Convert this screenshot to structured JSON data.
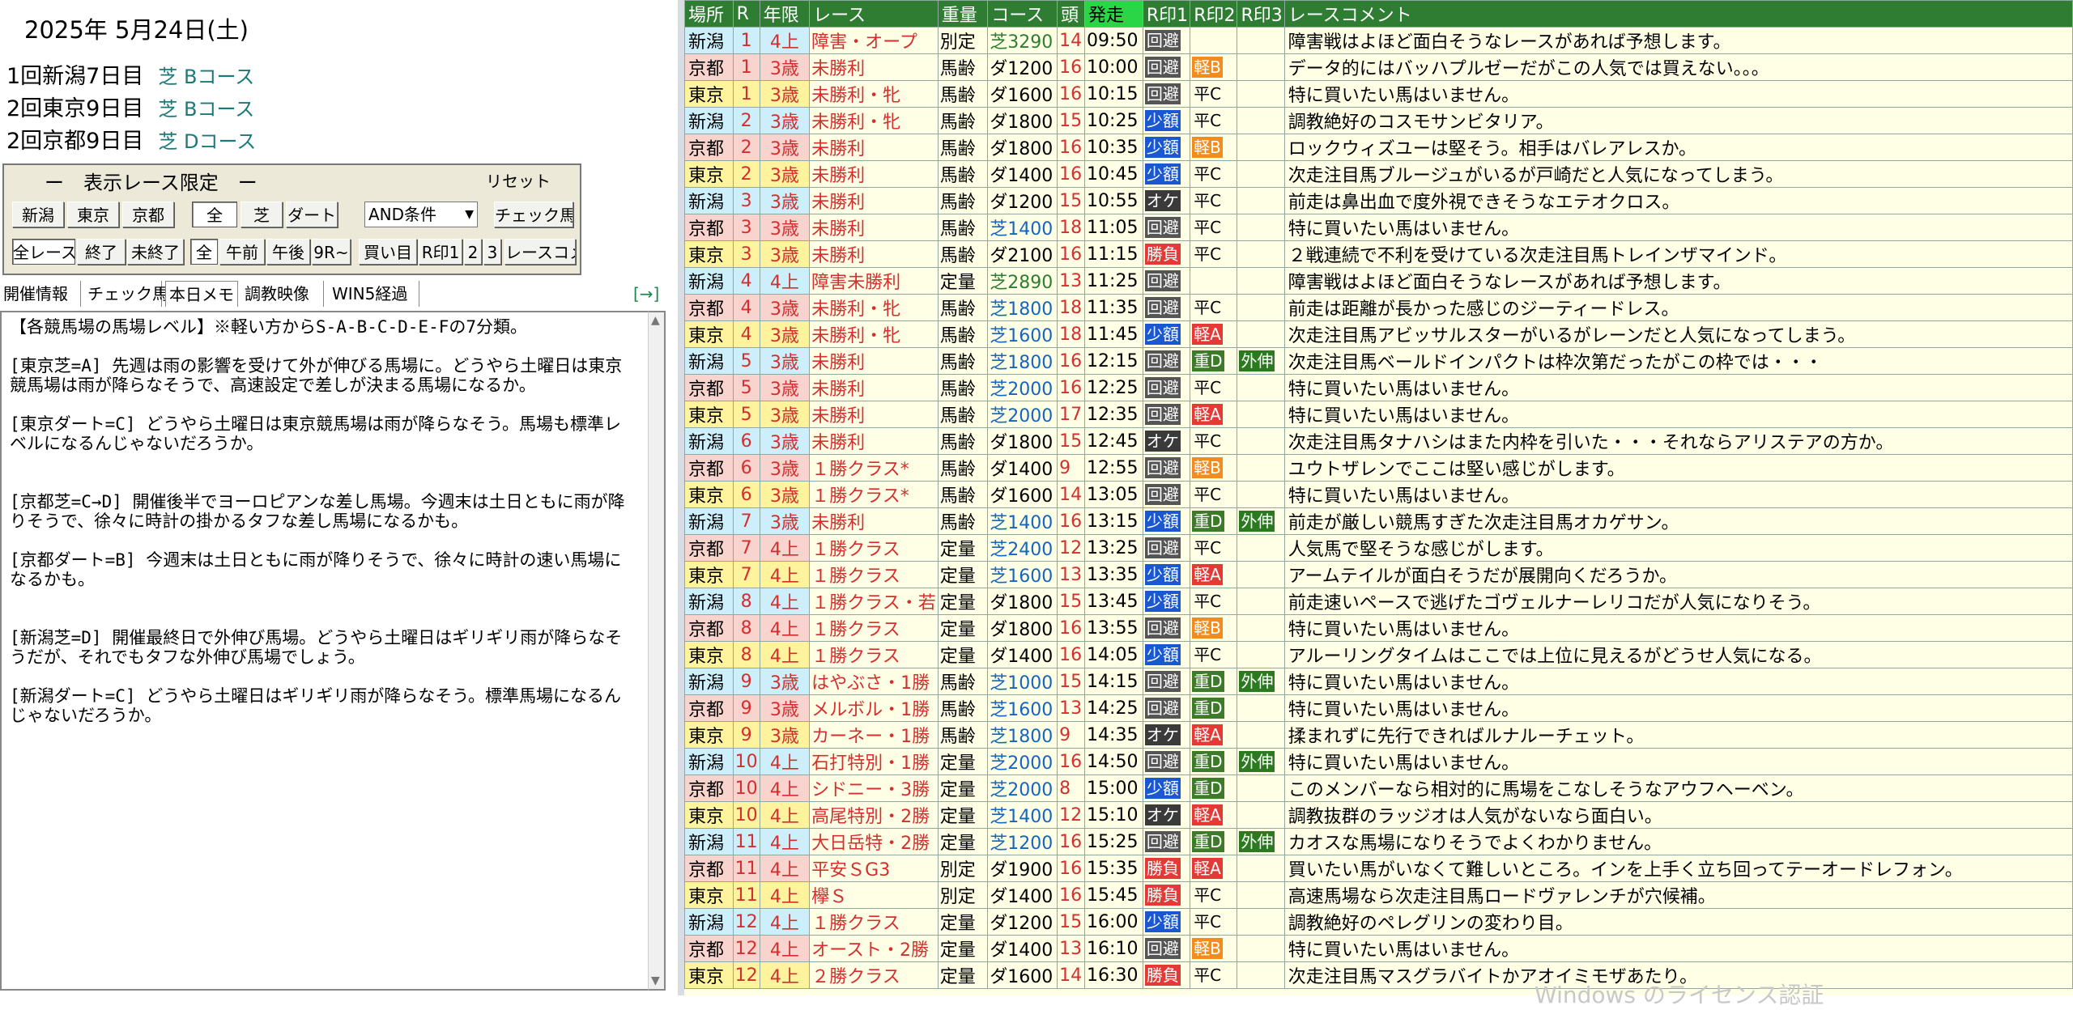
{
  "date": "2025年 5月24日(土)",
  "venues": [
    {
      "meet": "1回新潟7日目",
      "course": "芝 Bコース"
    },
    {
      "meet": "2回東京9日目",
      "course": "芝 Bコース"
    },
    {
      "meet": "2回京都9日目",
      "course": "芝 Dコース"
    }
  ],
  "filter_panel": {
    "title": "ー　表示レース限定　ー",
    "reset_label": "リセット",
    "row1": [
      "新潟",
      "東京",
      "京都",
      "全",
      "芝",
      "ダート"
    ],
    "condition_select": "AND条件",
    "check_horse_button": "チェック馬",
    "row2": [
      "全レース",
      "終了",
      "未終了",
      "全",
      "午前",
      "午後",
      "9R~",
      "買い目",
      "R印1",
      "2",
      "3",
      "レースコメ"
    ]
  },
  "tabs": [
    "開催情報",
    "チェック馬",
    "本日メモ",
    "調教映像",
    "WIN5経過"
  ],
  "active_tab": "本日メモ",
  "arrow_link": "[→]",
  "memo": "【各競馬場の馬場レベル】※軽い方からS-A-B-C-D-E-Fの7分類。\n\n[東京芝=A] 先週は雨の影響を受けて外が伸びる馬場に。どうやら土曜日は東京競馬場は雨が降らなそうで、高速設定で差しが決まる馬場になるか。\n\n[東京ダート=C] どうやら土曜日は東京競馬場は雨が降らなそう。馬場も標準レベルになるんじゃないだろうか。\n\n\n[京都芝=C→D] 開催後半でヨーロピアンな差し馬場。今週末は土日ともに雨が降りそうで、徐々に時計の掛かるタフな差し馬場になるかも。\n\n[京都ダート=B] 今週末は土日ともに雨が降りそうで、徐々に時計の速い馬場になるかも。\n\n\n[新潟芝=D] 開催最終日で外伸び馬場。どうやら土曜日はギリギリ雨が降らなそうだが、それでもタフな外伸び馬場でしょう。\n\n[新潟ダート=C] どうやら土曜日はギリギリ雨が降らなそう。標準馬場になるんじゃないだろうか。",
  "table": {
    "headers": [
      "場所",
      "R",
      "年限",
      "レース",
      "重量",
      "コース",
      "頭",
      "発走",
      "R印1",
      "R印2",
      "R印3",
      "レースコメント"
    ],
    "rows": [
      [
        "新潟",
        "1",
        "4上",
        "障害・オープ",
        "別定",
        "芝3290",
        "14",
        "09:50",
        "回避",
        "",
        "",
        "障害戦はよほど面白そうなレースがあれば予想します。"
      ],
      [
        "京都",
        "1",
        "3歳",
        "未勝利",
        "馬齢",
        "ダ1200",
        "16",
        "10:00",
        "回避",
        "軽B",
        "",
        "データ的にはバッハプルゼーだがこの人気では買えない。。。"
      ],
      [
        "東京",
        "1",
        "3歳",
        "未勝利・牝",
        "馬齢",
        "ダ1600",
        "16",
        "10:15",
        "回避",
        "平C",
        "",
        "特に買いたい馬はいません。"
      ],
      [
        "新潟",
        "2",
        "3歳",
        "未勝利・牝",
        "馬齢",
        "ダ1800",
        "15",
        "10:25",
        "少額",
        "平C",
        "",
        "調教絶好のコスモサンビタリア。"
      ],
      [
        "京都",
        "2",
        "3歳",
        "未勝利",
        "馬齢",
        "ダ1800",
        "16",
        "10:35",
        "少額",
        "軽B",
        "",
        "ロックウィズユーは堅そう。相手はバレアレスか。"
      ],
      [
        "東京",
        "2",
        "3歳",
        "未勝利",
        "馬齢",
        "ダ1400",
        "16",
        "10:45",
        "少額",
        "平C",
        "",
        "次走注目馬ブルージュがいるが戸崎だと人気になってしまう。"
      ],
      [
        "新潟",
        "3",
        "3歳",
        "未勝利",
        "馬齢",
        "ダ1200",
        "15",
        "10:55",
        "オケ",
        "平C",
        "",
        "前走は鼻出血で度外視できそうなエテオクロス。"
      ],
      [
        "京都",
        "3",
        "3歳",
        "未勝利",
        "馬齢",
        "芝1400",
        "18",
        "11:05",
        "回避",
        "平C",
        "",
        "特に買いたい馬はいません。"
      ],
      [
        "東京",
        "3",
        "3歳",
        "未勝利",
        "馬齢",
        "ダ2100",
        "16",
        "11:15",
        "勝負",
        "平C",
        "",
        "２戦連続で不利を受けている次走注目馬トレインザマインド。"
      ],
      [
        "新潟",
        "4",
        "4上",
        "障害未勝利",
        "定量",
        "芝2890",
        "13",
        "11:25",
        "回避",
        "",
        "",
        "障害戦はよほど面白そうなレースがあれば予想します。"
      ],
      [
        "京都",
        "4",
        "3歳",
        "未勝利・牝",
        "馬齢",
        "芝1800",
        "18",
        "11:35",
        "回避",
        "平C",
        "",
        "前走は距離が長かった感じのジーティードレス。"
      ],
      [
        "東京",
        "4",
        "3歳",
        "未勝利・牝",
        "馬齢",
        "芝1600",
        "18",
        "11:45",
        "少額",
        "軽A",
        "",
        "次走注目馬アビッサルスターがいるがレーンだと人気になってしまう。"
      ],
      [
        "新潟",
        "5",
        "3歳",
        "未勝利",
        "馬齢",
        "芝1800",
        "16",
        "12:15",
        "回避",
        "重D",
        "外伸",
        "次走注目馬ベールドインパクトは枠次第だったがこの枠では・・・"
      ],
      [
        "京都",
        "5",
        "3歳",
        "未勝利",
        "馬齢",
        "芝2000",
        "16",
        "12:25",
        "回避",
        "平C",
        "",
        "特に買いたい馬はいません。"
      ],
      [
        "東京",
        "5",
        "3歳",
        "未勝利",
        "馬齢",
        "芝2000",
        "17",
        "12:35",
        "回避",
        "軽A",
        "",
        "特に買いたい馬はいません。"
      ],
      [
        "新潟",
        "6",
        "3歳",
        "未勝利",
        "馬齢",
        "ダ1800",
        "15",
        "12:45",
        "オケ",
        "平C",
        "",
        "次走注目馬タナハシはまた内枠を引いた・・・それならアリステアの方か。"
      ],
      [
        "京都",
        "6",
        "3歳",
        "１勝クラス*",
        "馬齢",
        "ダ1400",
        "9",
        "12:55",
        "回避",
        "軽B",
        "",
        "ユウトザレンでここは堅い感じがします。"
      ],
      [
        "東京",
        "6",
        "3歳",
        "１勝クラス*",
        "馬齢",
        "ダ1600",
        "14",
        "13:05",
        "回避",
        "平C",
        "",
        "特に買いたい馬はいません。"
      ],
      [
        "新潟",
        "7",
        "3歳",
        "未勝利",
        "馬齢",
        "芝1400",
        "16",
        "13:15",
        "少額",
        "重D",
        "外伸",
        "前走が厳しい競馬すぎた次走注目馬オカゲサン。"
      ],
      [
        "京都",
        "7",
        "4上",
        "１勝クラス",
        "定量",
        "芝2400",
        "12",
        "13:25",
        "回避",
        "平C",
        "",
        "人気馬で堅そうな感じがします。"
      ],
      [
        "東京",
        "7",
        "4上",
        "１勝クラス",
        "定量",
        "芝1600",
        "13",
        "13:35",
        "少額",
        "軽A",
        "",
        "アームテイルが面白そうだが展開向くだろうか。"
      ],
      [
        "新潟",
        "8",
        "4上",
        "１勝クラス・若",
        "定量",
        "ダ1800",
        "15",
        "13:45",
        "少額",
        "平C",
        "",
        "前走速いペースで逃げたゴヴェルナーレリコだが人気になりそう。"
      ],
      [
        "京都",
        "8",
        "4上",
        "１勝クラス",
        "定量",
        "ダ1800",
        "16",
        "13:55",
        "回避",
        "軽B",
        "",
        "特に買いたい馬はいません。"
      ],
      [
        "東京",
        "8",
        "4上",
        "１勝クラス",
        "定量",
        "ダ1400",
        "16",
        "14:05",
        "少額",
        "平C",
        "",
        "アルーリングタイムはここでは上位に見えるがどうせ人気になる。"
      ],
      [
        "新潟",
        "9",
        "3歳",
        "はやぶさ・1勝",
        "馬齢",
        "芝1000",
        "15",
        "14:15",
        "回避",
        "重D",
        "外伸",
        "特に買いたい馬はいません。"
      ],
      [
        "京都",
        "9",
        "3歳",
        "メルボル・1勝",
        "馬齢",
        "芝1600",
        "13",
        "14:25",
        "回避",
        "重D",
        "",
        "特に買いたい馬はいません。"
      ],
      [
        "東京",
        "9",
        "3歳",
        "カーネー・1勝",
        "馬齢",
        "芝1800",
        "9",
        "14:35",
        "オケ",
        "軽A",
        "",
        "揉まれずに先行できればルナルーチェット。"
      ],
      [
        "新潟",
        "10",
        "4上",
        "石打特別・1勝",
        "定量",
        "芝2000",
        "16",
        "14:50",
        "回避",
        "重D",
        "外伸",
        "特に買いたい馬はいません。"
      ],
      [
        "京都",
        "10",
        "4上",
        "シドニー・3勝",
        "定量",
        "芝2000",
        "8",
        "15:00",
        "少額",
        "重D",
        "",
        "このメンバーなら相対的に馬場をこなしそうなアウフヘーベン。"
      ],
      [
        "東京",
        "10",
        "4上",
        "高尾特別・2勝",
        "定量",
        "芝1400",
        "12",
        "15:10",
        "オケ",
        "軽A",
        "",
        "調教抜群のラッジオは人気がないなら面白い。"
      ],
      [
        "新潟",
        "11",
        "4上",
        "大日岳特・2勝",
        "定量",
        "芝1200",
        "16",
        "15:25",
        "回避",
        "重D",
        "外伸",
        "カオスな馬場になりそうでよくわかりません。"
      ],
      [
        "京都",
        "11",
        "4上",
        "平安ＳG3",
        "別定",
        "ダ1900",
        "16",
        "15:35",
        "勝負",
        "軽A",
        "",
        "買いたい馬がいなくて難しいところ。インを上手く立ち回ってテーオードレフォン。"
      ],
      [
        "東京",
        "11",
        "4上",
        "欅Ｓ",
        "別定",
        "ダ1400",
        "16",
        "15:45",
        "勝負",
        "平C",
        "",
        "高速馬場なら次走注目馬ロードヴァレンチが穴候補。"
      ],
      [
        "新潟",
        "12",
        "4上",
        "１勝クラス",
        "定量",
        "ダ1200",
        "15",
        "16:00",
        "少額",
        "平C",
        "",
        "調教絶好のペレグリンの変わり目。"
      ],
      [
        "京都",
        "12",
        "4上",
        "オースト・2勝",
        "定量",
        "ダ1400",
        "13",
        "16:10",
        "回避",
        "軽B",
        "",
        "特に買いたい馬はいません。"
      ],
      [
        "東京",
        "12",
        "4上",
        "２勝クラス",
        "定量",
        "ダ1600",
        "14",
        "16:30",
        "勝負",
        "平C",
        "",
        "次走注目馬マスグラバイトかアオイミモザあたり。"
      ]
    ]
  },
  "colors": {
    "header_bg": "#2e7d32",
    "header_hot": "#2bd646",
    "niigata": "#cdeffc",
    "kyoto": "#f9d3ce",
    "tokyo": "#fff39d",
    "race_red": "#d32f2f",
    "course_shiba": "#1565c0",
    "course_shiba_long": "#2e7d32",
    "kaihi": "#555555",
    "shougaku": "#1a57d0",
    "oke": "#3a3a3a",
    "shoubu": "#e53935",
    "kei_a": "#e53935",
    "kei_b": "#f28c1e",
    "juu_d": "#3d7a2a",
    "sotonobi": "#2b7a1f"
  },
  "watermark": "Windows のライセンス認証"
}
